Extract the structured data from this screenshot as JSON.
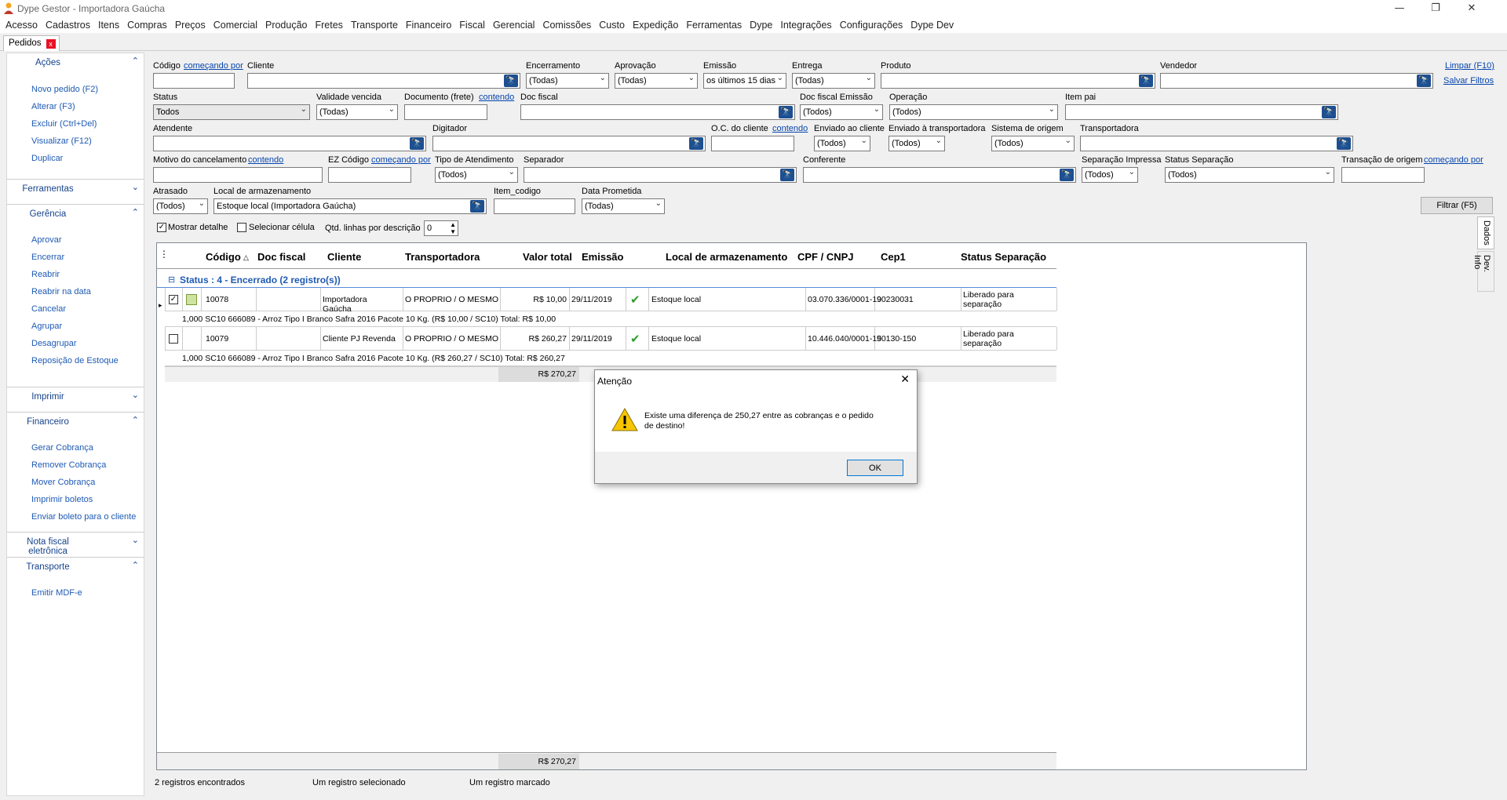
{
  "window": {
    "title": "Dype Gestor - Importadora Gaúcha",
    "min": "—",
    "restore": "❐",
    "close": "✕"
  },
  "menu": [
    "Acesso",
    "Cadastros",
    "Itens",
    "Compras",
    "Preços",
    "Comercial",
    "Produção",
    "Fretes",
    "Transporte",
    "Financeiro",
    "Fiscal",
    "Gerencial",
    "Comissões",
    "Custo",
    "Expedição",
    "Ferramentas",
    "Dype",
    "Integrações",
    "Configurações",
    "Dype Dev"
  ],
  "tab": {
    "label": "Pedidos",
    "close": "x"
  },
  "sidebar": {
    "acoes": {
      "title": "Ações",
      "chev": "⌃",
      "items": [
        "Novo pedido (F2)",
        "Alterar (F3)",
        "Excluir (Ctrl+Del)",
        "Visualizar (F12)",
        "Duplicar"
      ]
    },
    "ferramentas": {
      "title": "Ferramentas",
      "chev": "⌄"
    },
    "gerencia": {
      "title": "Gerência",
      "chev": "⌃",
      "items": [
        "Aprovar",
        "Encerrar",
        "Reabrir",
        "Reabrir na data",
        "Cancelar",
        "Agrupar",
        "Desagrupar",
        "Reposição de Estoque"
      ]
    },
    "imprimir": {
      "title": "Imprimir",
      "chev": "⌄"
    },
    "financeiro": {
      "title": "Financeiro",
      "chev": "⌃",
      "items": [
        "Gerar Cobrança",
        "Remover Cobrança",
        "Mover Cobrança",
        "Imprimir boletos",
        "Enviar boleto para o cliente"
      ]
    },
    "nfe": {
      "title": "Nota fiscal eletrônica",
      "chev": "⌄"
    },
    "transporte": {
      "title": "Transporte",
      "chev": "⌃",
      "items": [
        "Emitir MDF-e"
      ]
    }
  },
  "filters": {
    "codigo": "Código",
    "codigo_link": "começando por",
    "cliente": "Cliente",
    "encerramento": "Encerramento",
    "encerramento_val": "(Todas)",
    "aprovacao": "Aprovação",
    "aprovacao_val": "(Todas)",
    "emissao": "Emissão",
    "emissao_val": "os últimos 15 dias",
    "entrega": "Entrega",
    "entrega_val": "(Todas)",
    "produto": "Produto",
    "vendedor": "Vendedor",
    "limpar": "Limpar (F10)",
    "salvar": "Salvar Filtros",
    "status": "Status",
    "status_val": "Todos",
    "validade": "Validade vencida",
    "validade_val": "(Todas)",
    "documento": "Documento (frete)",
    "documento_link": "contendo",
    "docfiscal": "Doc fiscal",
    "docfiscal_emissao": "Doc fiscal Emissão",
    "docfiscal_emissao_val": "(Todos)",
    "operacao": "Operação",
    "operacao_val": "(Todos)",
    "itempai": "Item pai",
    "atendente": "Atendente",
    "digitador": "Digitador",
    "oc": "O.C. do cliente",
    "oc_link": "contendo",
    "enviado_cliente": "Enviado ao cliente",
    "enviado_cliente_val": "(Todos)",
    "enviado_transp": "Enviado à transportadora",
    "enviado_transp_val": "(Todos)",
    "sistema": "Sistema de origem",
    "sistema_val": "(Todos)",
    "transportadora": "Transportadora",
    "motivo": "Motivo do cancelamento",
    "motivo_link": "contendo",
    "ez": "EZ Código",
    "ez_link": "começando por",
    "tipo": "Tipo de Atendimento",
    "tipo_val": "(Todos)",
    "separador": "Separador",
    "conferente": "Conferente",
    "sep_impressa": "Separação Impressa",
    "sep_impressa_val": "(Todos)",
    "status_sep": "Status Separação",
    "status_sep_val": "(Todos)",
    "transacao": "Transação de origem",
    "transacao_link": "começando por",
    "atrasado": "Atrasado",
    "atrasado_val": "(Todos)",
    "local": "Local de armazenamento",
    "local_val": "Estoque local (Importadora Gaúcha)",
    "item_codigo": "Item_codigo",
    "data_prometida": "Data Prometida",
    "data_prometida_val": "(Todas)",
    "filtrar": "Filtrar (F5)",
    "mostrar_detalhe": "Mostrar detalhe",
    "mostrar_check": "✓",
    "selecionar_celula": "Selecionar célula",
    "qtd_linhas": "Qtd. linhas por descrição",
    "qtd_val": "0"
  },
  "binocular": "🔭",
  "grid": {
    "columns": [
      "Código",
      "Doc fiscal",
      "Cliente",
      "Transportadora",
      "Valor total",
      "Emissão",
      "Local de armazenamento",
      "CPF / CNPJ",
      "Cep1",
      "Status Separação"
    ],
    "sort_mark": "△",
    "group": "Status : 4 - Encerrado (2 registro(s))",
    "group_toggle": "⊟",
    "rows": [
      {
        "check": "✓",
        "codigo": "10078",
        "cliente": "Importadora Gaúcha",
        "transportadora": "O PROPRIO / O MESMO",
        "valor": "R$ 10,00",
        "emissao": "29/11/2019",
        "ok": "✔",
        "local": "Estoque local",
        "cnpj": "03.070.336/0001-19",
        "cep": "90230031",
        "status": "Liberado para separação",
        "detail": "1,000 SC10 666089 - Arroz Tipo I Branco Safra 2016 Pacote 10 Kg. (R$ 10,00 / SC10)   Total: R$ 10,00"
      },
      {
        "check": "",
        "codigo": "10079",
        "cliente": "Cliente PJ Revenda",
        "transportadora": "O PROPRIO / O MESMO",
        "valor": "R$ 260,27",
        "emissao": "29/11/2019",
        "ok": "✔",
        "local": "Estoque local",
        "cnpj": "10.446.040/0001-15",
        "cep": "90130-150",
        "status": "Liberado para separação",
        "detail": "1,000 SC10 666089 - Arroz Tipo I Branco Safra 2016 Pacote 10 Kg. (R$ 260,27 / SC10)   Total: R$ 260,27"
      }
    ],
    "group_total": "R$ 270,27",
    "footer_total": "R$ 270,27",
    "row_indicator": "▸"
  },
  "sidetabs": [
    "Dados",
    "Dev. Info"
  ],
  "status": [
    "2 registros encontrados",
    "Um registro selecionado",
    "Um registro marcado"
  ],
  "dialog": {
    "title": "Atenção",
    "close": "✕",
    "message": "Existe uma diferença de 250,27 entre as cobranças e o pedido de destino!",
    "ok": "OK",
    "warn": "!"
  }
}
